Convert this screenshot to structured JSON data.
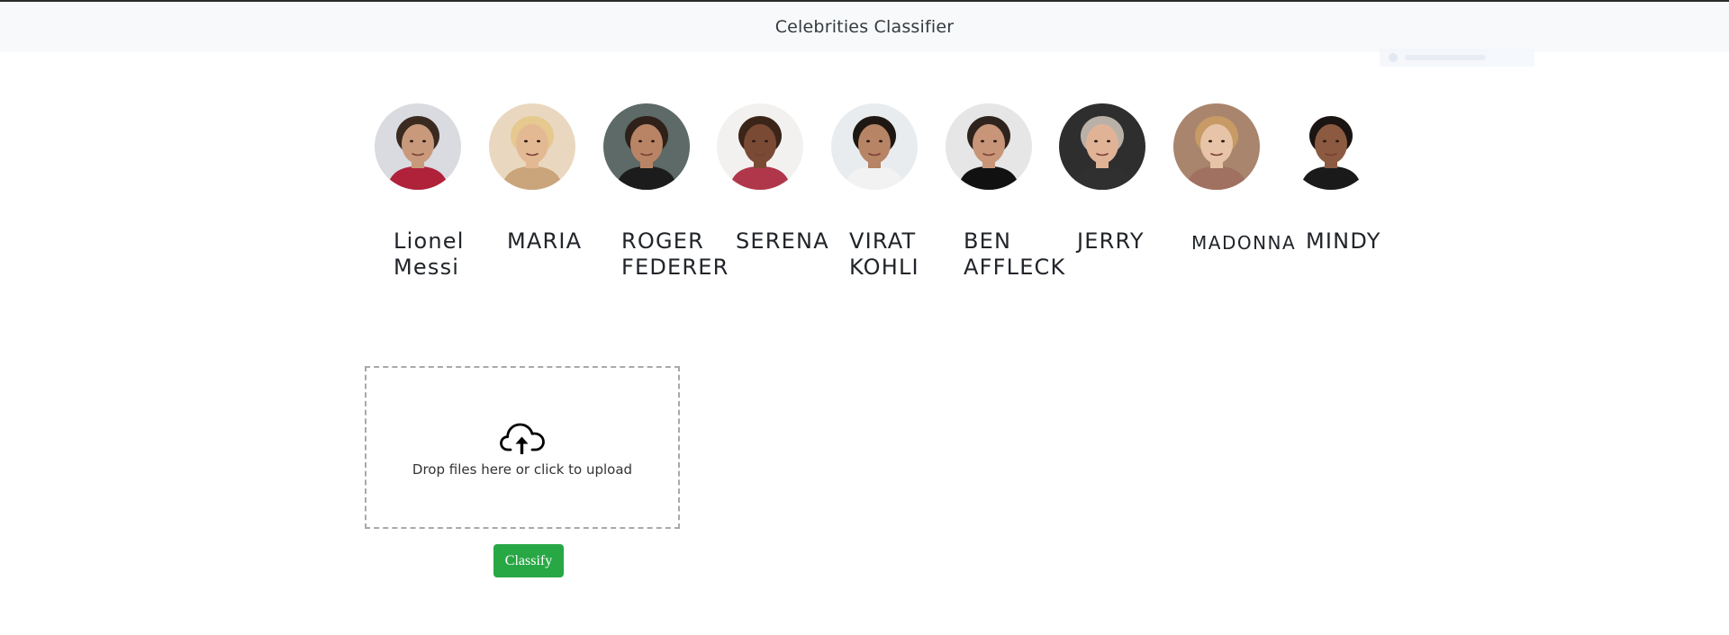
{
  "navbar": {
    "title": "Celebrities Classifier"
  },
  "celebrities": [
    {
      "name": "Lionel\nMessi",
      "bg": "#d9dbe0",
      "skin": "#c89a7b",
      "hair": "#3a2a20",
      "shirt": "#b0213a"
    },
    {
      "name": "MARIA",
      "bg": "#e9d8bf",
      "skin": "#e3b994",
      "hair": "#e6c98f",
      "shirt": "#caa47a"
    },
    {
      "name": "ROGER\nFEDERER",
      "bg": "#5d6a67",
      "skin": "#b98466",
      "hair": "#2f2119",
      "shirt": "#1c1c1c"
    },
    {
      "name": "SERENA",
      "bg": "#f3f1f0",
      "skin": "#7a4a35",
      "hair": "#3b2418",
      "shirt": "#b0374a"
    },
    {
      "name": "VIRAT\nKOHLI",
      "bg": "#e8ecef",
      "skin": "#b78466",
      "hair": "#1e1712",
      "shirt": "#f2f2f2"
    },
    {
      "name": "BEN\nAFFLECK",
      "bg": "#e6e6e6",
      "skin": "#c89579",
      "hair": "#2e241d",
      "shirt": "#111111"
    },
    {
      "name": "JERRY",
      "bg": "#2e2e2e",
      "skin": "#e0b396",
      "hair": "#b9b1a8",
      "shirt": "#303030"
    },
    {
      "name": "MADONNA",
      "bg": "#a9856d",
      "skin": "#e7c3a7",
      "hair": "#c79a66",
      "shirt": "#a07060"
    },
    {
      "name": "MINDY",
      "bg": "#ffffff",
      "skin": "#8b5a41",
      "hair": "#1a1412",
      "shirt": "#1a1a1a"
    }
  ],
  "upload": {
    "message": "Drop files here or click to upload",
    "icon": "cloud-upload-icon"
  },
  "classify": {
    "label": "Classify",
    "color": "#28a745"
  }
}
